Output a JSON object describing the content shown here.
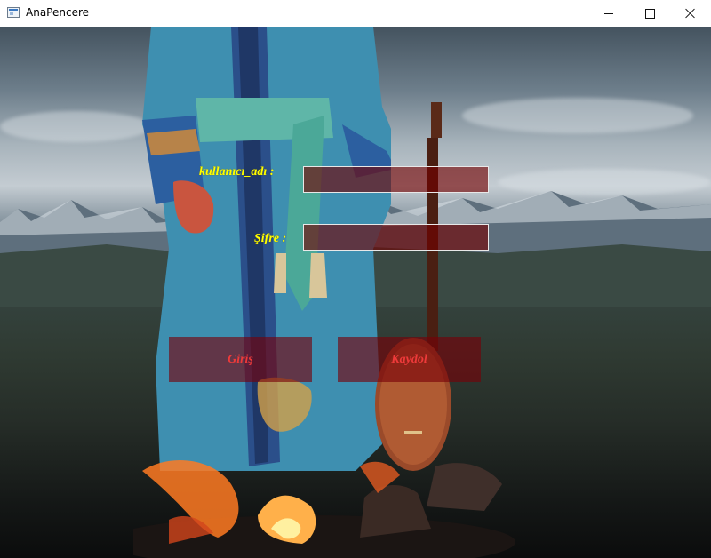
{
  "window": {
    "title": "AnaPencere",
    "icon": "app-window-icon",
    "controls": [
      "minimize-icon",
      "maximize-icon",
      "close-icon"
    ]
  },
  "form": {
    "username_label": "kullanıcı_adı :",
    "password_label": "Şifre :",
    "username_value": "",
    "password_value": "",
    "login_button": "Giriş",
    "register_button": "Kaydol"
  },
  "colors": {
    "label_text": "#ffff00",
    "button_text": "#ee3a3a",
    "field_background": "#730000",
    "titlebar": "#ffffff"
  }
}
